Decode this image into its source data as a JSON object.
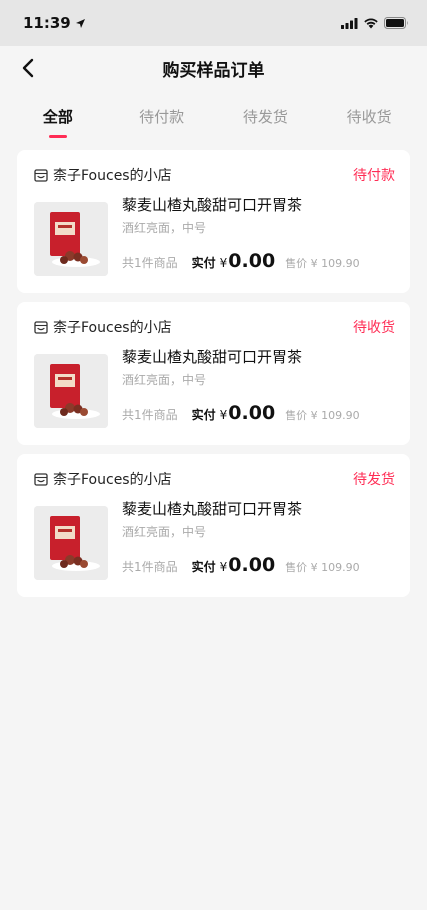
{
  "status_bar": {
    "time": "11:39"
  },
  "nav": {
    "title": "购买样品订单"
  },
  "tabs": [
    {
      "label": "全部",
      "active": true
    },
    {
      "label": "待付款",
      "active": false
    },
    {
      "label": "待发货",
      "active": false
    },
    {
      "label": "待收货",
      "active": false
    }
  ],
  "orders": [
    {
      "shop": "柰子Fouces的小店",
      "status": "待付款",
      "product_name": "藜麦山楂丸酸甜可口开胃茶",
      "spec": "酒红亮面，中号",
      "count": "共1件商品",
      "paid_label": "实付",
      "currency": "¥",
      "amount": "0.00",
      "original_price": "售价 ¥ 109.90"
    },
    {
      "shop": "柰子Fouces的小店",
      "status": "待收货",
      "product_name": "藜麦山楂丸酸甜可口开胃茶",
      "spec": "酒红亮面，中号",
      "count": "共1件商品",
      "paid_label": "实付",
      "currency": "¥",
      "amount": "0.00",
      "original_price": "售价 ¥ 109.90"
    },
    {
      "shop": "柰子Fouces的小店",
      "status": "待发货",
      "product_name": "藜麦山楂丸酸甜可口开胃茶",
      "spec": "酒红亮面，中号",
      "count": "共1件商品",
      "paid_label": "实付",
      "currency": "¥",
      "amount": "0.00",
      "original_price": "售价 ¥ 109.90"
    }
  ],
  "colors": {
    "accent": "#ff2d55",
    "background": "#f5f5f5",
    "muted": "#aaaaaa"
  },
  "icons": [
    "location-arrow-icon",
    "signal-icon",
    "wifi-icon",
    "battery-icon",
    "back-chevron-icon",
    "shop-icon"
  ]
}
